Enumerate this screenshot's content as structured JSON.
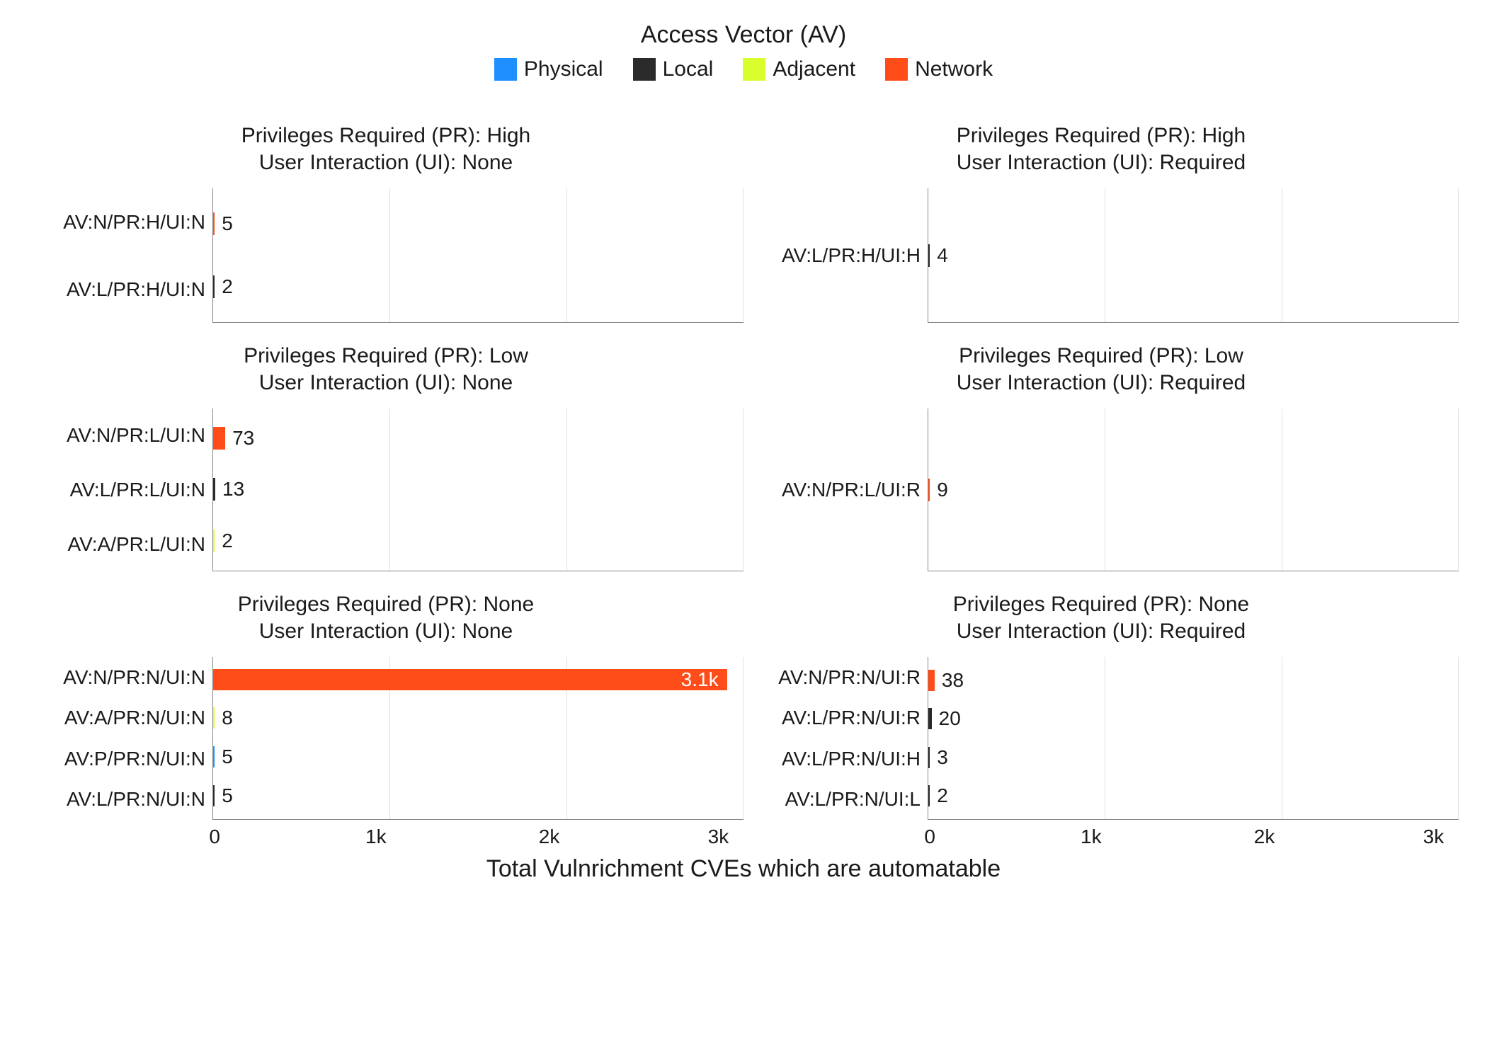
{
  "legend": {
    "title": "Access Vector (AV)",
    "items": [
      {
        "name": "Physical",
        "color": "#1f8fff"
      },
      {
        "name": "Local",
        "color": "#2b2b2b"
      },
      {
        "name": "Adjacent",
        "color": "#d8ff2b"
      },
      {
        "name": "Network",
        "color": "#ff4d1a"
      }
    ]
  },
  "xlabel": "Total Vulnrichment CVEs which are automatable",
  "xaxis": {
    "ticks": [
      "0",
      "1k",
      "2k",
      "3k"
    ],
    "max": 3200
  },
  "chart_data": {
    "type": "bar",
    "xlim": [
      0,
      3200
    ],
    "xticks": [
      0,
      1000,
      2000,
      3000
    ],
    "xlabel": "Total Vulnrichment CVEs which are automatable",
    "legend_title": "Access Vector (AV)",
    "facets": [
      {
        "row": 0,
        "col": 0,
        "title_lines": [
          "Privileges Required (PR): High",
          "User Interaction (UI): None"
        ],
        "bars": [
          {
            "category": "AV:N/PR:H/UI:N",
            "value": 5,
            "label": "5",
            "series": "Network"
          },
          {
            "category": "AV:L/PR:H/UI:N",
            "value": 2,
            "label": "2",
            "series": "Local"
          }
        ]
      },
      {
        "row": 0,
        "col": 1,
        "title_lines": [
          "Privileges Required (PR): High",
          "User Interaction (UI): Required"
        ],
        "bars": [
          {
            "category": "AV:L/PR:H/UI:H",
            "value": 4,
            "label": "4",
            "series": "Local"
          }
        ]
      },
      {
        "row": 1,
        "col": 0,
        "title_lines": [
          "Privileges Required (PR): Low",
          "User Interaction (UI): None"
        ],
        "bars": [
          {
            "category": "AV:N/PR:L/UI:N",
            "value": 73,
            "label": "73",
            "series": "Network"
          },
          {
            "category": "AV:L/PR:L/UI:N",
            "value": 13,
            "label": "13",
            "series": "Local"
          },
          {
            "category": "AV:A/PR:L/UI:N",
            "value": 2,
            "label": "2",
            "series": "Adjacent"
          }
        ]
      },
      {
        "row": 1,
        "col": 1,
        "title_lines": [
          "Privileges Required (PR): Low",
          "User Interaction (UI): Required"
        ],
        "bars": [
          {
            "category": "AV:N/PR:L/UI:R",
            "value": 9,
            "label": "9",
            "series": "Network"
          }
        ]
      },
      {
        "row": 2,
        "col": 0,
        "title_lines": [
          "Privileges Required (PR): None",
          "User Interaction (UI): None"
        ],
        "bars": [
          {
            "category": "AV:N/PR:N/UI:N",
            "value": 3100,
            "label": "3.1k",
            "series": "Network",
            "label_inside": true
          },
          {
            "category": "AV:A/PR:N/UI:N",
            "value": 8,
            "label": "8",
            "series": "Adjacent"
          },
          {
            "category": "AV:P/PR:N/UI:N",
            "value": 5,
            "label": "5",
            "series": "Physical"
          },
          {
            "category": "AV:L/PR:N/UI:N",
            "value": 5,
            "label": "5",
            "series": "Local"
          }
        ]
      },
      {
        "row": 2,
        "col": 1,
        "title_lines": [
          "Privileges Required (PR): None",
          "User Interaction (UI): Required"
        ],
        "bars": [
          {
            "category": "AV:N/PR:N/UI:R",
            "value": 38,
            "label": "38",
            "series": "Network"
          },
          {
            "category": "AV:L/PR:N/UI:R",
            "value": 20,
            "label": "20",
            "series": "Local"
          },
          {
            "category": "AV:L/PR:N/UI:H",
            "value": 3,
            "label": "3",
            "series": "Local"
          },
          {
            "category": "AV:L/PR:N/UI:L",
            "value": 2,
            "label": "2",
            "series": "Local"
          }
        ]
      }
    ]
  }
}
